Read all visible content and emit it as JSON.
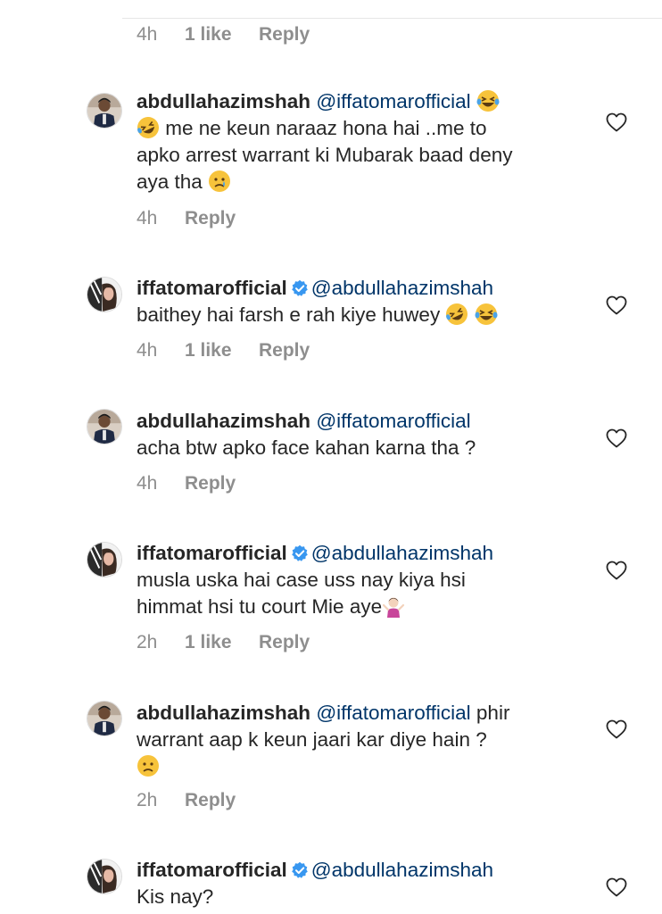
{
  "top_meta": {
    "time": "4h",
    "likes": "1 like",
    "reply": "Reply"
  },
  "comments": [
    {
      "username": "abdullahazimshah",
      "verified": false,
      "mention": "@iffatomarofficial",
      "line1_rest": "",
      "line2": "me ne keun naraaz hona hai ..me to",
      "line3": "apko arrest warrant ki Mubarak baad deny",
      "line4": "aya tha",
      "time": "4h",
      "likes": "",
      "reply": "Reply"
    },
    {
      "username": "iffatomarofficial",
      "verified": true,
      "mention": "@abdullahazimshah",
      "line2": "baithey hai farsh e rah kiye huwey",
      "time": "4h",
      "likes": "1 like",
      "reply": "Reply"
    },
    {
      "username": "abdullahazimshah",
      "verified": false,
      "mention": "@iffatomarofficial",
      "line2": "acha btw apko face kahan karna tha ?",
      "time": "4h",
      "likes": "",
      "reply": "Reply"
    },
    {
      "username": "iffatomarofficial",
      "verified": true,
      "mention": "@abdullahazimshah",
      "line2": "musla uska hai case uss nay kiya hsi",
      "line3": "himmat hsi tu court Mie aye",
      "time": "2h",
      "likes": "1 like",
      "reply": "Reply"
    },
    {
      "username": "abdullahazimshah",
      "verified": false,
      "mention": "@iffatomarofficial",
      "line1_rest": "phir",
      "line2": "warrant aap k keun jaari kar diye hain ?",
      "time": "2h",
      "likes": "",
      "reply": "Reply"
    },
    {
      "username": "iffatomarofficial",
      "verified": true,
      "mention": "@abdullahazimshah",
      "line2": "Kis nay?"
    }
  ],
  "colors": {
    "mention": "#003569",
    "meta": "#8e8e8e",
    "verified": "#3897f0",
    "text": "#262626"
  },
  "icons": [
    "heart-outline-icon",
    "verified-badge-icon",
    "avatar-man-icon",
    "avatar-woman-icon"
  ]
}
